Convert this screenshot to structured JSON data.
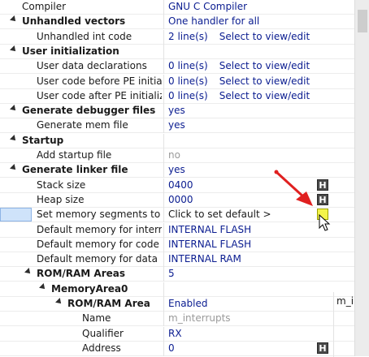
{
  "rows": [
    {
      "label": "Compiler",
      "value": "GNU C Compiler",
      "valueStyle": "link"
    },
    {
      "label": "Unhandled vectors",
      "value": "One handler for all",
      "bold": true,
      "expander": true,
      "valueStyle": "link"
    },
    {
      "label": "Unhandled int code",
      "value": "2 line(s)",
      "link": "Select to view/edit",
      "valueStyle": "link"
    },
    {
      "label": "User initialization",
      "value": "",
      "bold": true,
      "expander": true
    },
    {
      "label": "User data declarations",
      "value": "0 line(s)",
      "link": "Select to view/edit",
      "valueStyle": "link"
    },
    {
      "label": "User code before PE initializat",
      "value": "0 line(s)",
      "link": "Select to view/edit",
      "valueStyle": "link"
    },
    {
      "label": "User code after PE initializatio",
      "value": "0 line(s)",
      "link": "Select to view/edit",
      "valueStyle": "link"
    },
    {
      "label": "Generate debugger files",
      "value": "yes",
      "bold": true,
      "expander": true,
      "valueStyle": "link"
    },
    {
      "label": "Generate mem file",
      "value": "yes",
      "valueStyle": "link"
    },
    {
      "label": "Startup",
      "value": "",
      "bold": true,
      "expander": true
    },
    {
      "label": "Add startup file",
      "value": "no",
      "valueStyle": "gray"
    },
    {
      "label": "Generate linker file",
      "value": "yes",
      "bold": true,
      "expander": true,
      "valueStyle": "link"
    },
    {
      "label": "Stack size",
      "value": "0400",
      "hbtn": "H",
      "valueStyle": "link"
    },
    {
      "label": "Heap size",
      "value": "0000",
      "hbtn": "H",
      "valueStyle": "link"
    },
    {
      "label": "Set memory segments to defa",
      "value": "Click to set default >",
      "hbtn": "",
      "hbtnYellow": true,
      "selected": true,
      "valueStyle": "black"
    },
    {
      "label": "Default memory for interrupts",
      "value": "INTERNAL FLASH",
      "valueStyle": "link"
    },
    {
      "label": "Default memory for code",
      "value": "INTERNAL FLASH",
      "valueStyle": "link"
    },
    {
      "label": "Default memory for data",
      "value": "INTERNAL RAM",
      "valueStyle": "link"
    },
    {
      "label": "ROM/RAM Areas",
      "value": "5",
      "bold": true,
      "expander": true,
      "valueStyle": "link"
    },
    {
      "label": "MemoryArea0",
      "value": "",
      "bold": true,
      "expander": true
    },
    {
      "label": "ROM/RAM Area",
      "value": "Enabled",
      "bold": true,
      "expander": true,
      "valueStyle": "link"
    },
    {
      "label": "Name",
      "value": "m_interrupts",
      "valueStyle": "gray"
    },
    {
      "label": "Qualifier",
      "value": "RX",
      "valueStyle": "link"
    },
    {
      "label": "Address",
      "value": "0",
      "hbtn": "H",
      "valueStyle": "link"
    }
  ],
  "extra_cell": "m_ir",
  "colors": {
    "link": "#0a1c90",
    "gray": "#9a9a9a",
    "arrow": "#e02020",
    "selection": "#cfe3fa",
    "hbtn": "#4a4a4a",
    "hbtn_yellow": "#f4f44a"
  },
  "icons": {
    "expander": "expander-triangle-icon",
    "cursor": "mouse-pointer-icon",
    "annotation": "red-arrow-icon"
  }
}
